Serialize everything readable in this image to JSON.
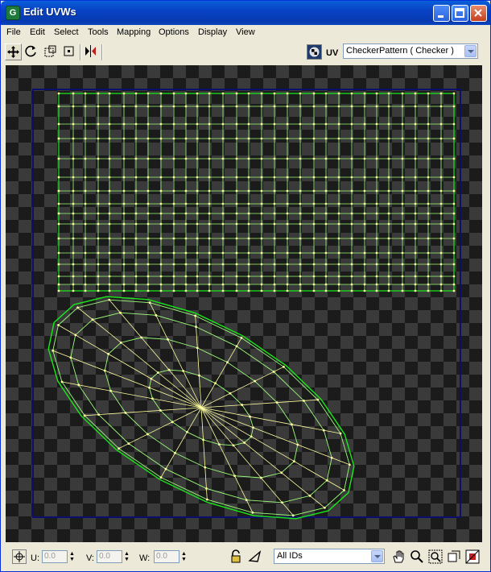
{
  "window": {
    "title": "Edit UVWs",
    "app_icon": "3ds-max-icon"
  },
  "menu": [
    "File",
    "Edit",
    "Select",
    "Tools",
    "Mapping",
    "Options",
    "Display",
    "View"
  ],
  "toolbar": {
    "tools": [
      "move-icon",
      "rotate-icon",
      "scale-icon",
      "freeform-icon",
      "mirror-icon"
    ],
    "uv_label": "UV",
    "texture_select": "CheckerPattern  ( Checker )"
  },
  "status": {
    "u_label": "U:",
    "u_value": "0.0",
    "v_label": "V:",
    "v_value": "0.0",
    "w_label": "W:",
    "w_value": "0.0",
    "id_select": "All IDs"
  },
  "colors": {
    "mesh_edge": "#9cff7a",
    "mesh_vertex": "#ffffa0",
    "selected_outline": "#19e819",
    "uv_frame": "#0a0f6e"
  }
}
